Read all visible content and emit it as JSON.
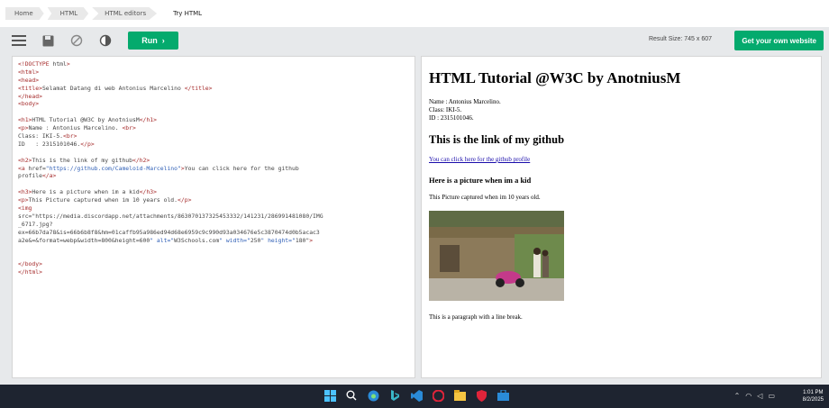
{
  "breadcrumbs": [
    "Home",
    "HTML",
    "HTML editors",
    "Try HTML"
  ],
  "toolbar": {
    "run_label": "Run",
    "result_size": "Result Size: 745 x 607",
    "get_website_label": "Get your own website"
  },
  "editor": {
    "lines": [
      "<!DOCTYPE html>",
      "<html>",
      "<head>",
      "<title>Selamat Datang di web Antonius Marcelino </title>",
      "</head>",
      "<body>",
      "",
      "<h1>HTML Tutorial @W3C by AnotniusM</h1>",
      "<p>Name : Antonius Marcelino. <br>",
      "Class: IKI-5.<br>",
      "ID   : 2315101046.</p>",
      "",
      "<h2>This is the link of my github</h2>",
      "<a href=\"https://github.com/Cameloid-Marcelino\">You can click here for the github",
      "profile</a>",
      "",
      "<h3>Here is a picture when im a kid</h3>",
      "<p>This Picture captured when im 10 years old.</p>",
      "<img",
      "src=\"https://media.discordapp.net/attachments/863070137325453332/141231/286991481080/IMG",
      "_6717.jpg?",
      "ex=66b7da78&is=66b6b8f8&hm=01caffb95a986ed94d68e6959c9c990d93a034676e5c3870474d0b5acac3",
      "a2e&=&format=webp&width=800&height=600\" alt=\"W3Schools.com\" width=\"250\" height=\"180\">",
      "",
      "",
      "</body>",
      "</html>"
    ]
  },
  "result": {
    "h1": "HTML Tutorial @W3C by AnotniusM",
    "name_line": "Name : Antonius Marcelino.",
    "class_line": "Class: IKI-5.",
    "id_line": "ID : 2315101046.",
    "h2": "This is the link of my github",
    "link_text": "You can click here for the github profile",
    "h3": "Here is a picture when im a kid",
    "caption": "This Picture captured when im 10 years old.",
    "image_alt": "W3Schools.com",
    "last_para": "This is a paragraph with a line break."
  },
  "taskbar": {
    "time": "1:01 PM",
    "date": "8/2/2025"
  },
  "colors": {
    "accent": "#04aa6d",
    "taskbar": "#1e2430"
  }
}
